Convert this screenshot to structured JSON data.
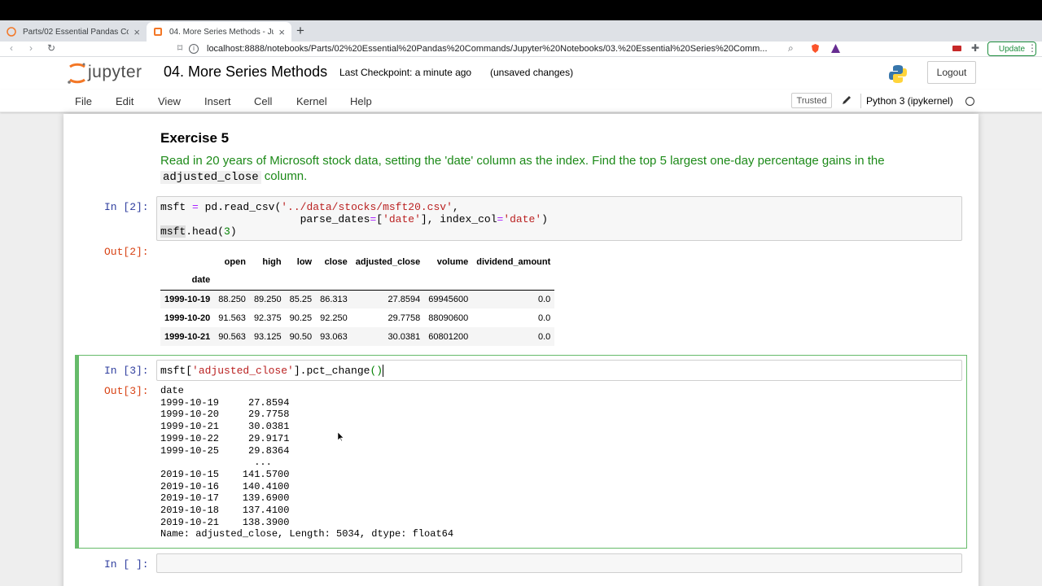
{
  "browser": {
    "tabs": [
      {
        "label": "Parts/02 Essential Pandas Comman",
        "active": false
      },
      {
        "label": "04. More Series Methods - Jupyt",
        "active": true
      }
    ],
    "url": "localhost:8888/notebooks/Parts/02%20Essential%20Pandas%20Commands/Jupyter%20Notebooks/03.%20Essential%20Series%20Comm...",
    "update_label": "Update"
  },
  "jupyter": {
    "logo_text": "jupyter",
    "notebook_title": "04. More Series Methods",
    "checkpoint": "Last Checkpoint: a minute ago",
    "save_status": "(unsaved changes)",
    "logout_label": "Logout",
    "menu": [
      "File",
      "Edit",
      "View",
      "Insert",
      "Cell",
      "Kernel",
      "Help"
    ],
    "trusted_label": "Trusted",
    "kernel_name": "Python 3 (ipykernel)"
  },
  "cells": {
    "exercise_heading": "Exercise 5",
    "exercise_text_pre": "Read in 20 years of Microsoft stock data, setting the 'date' column as the index. Find the top 5 largest one-day percentage gains in the",
    "exercise_code_word": "adjusted_close",
    "exercise_text_post": "column.",
    "cell2_in_prompt": "In [2]:",
    "cell2_out_prompt": "Out[2]:",
    "cell3_in_prompt": "In [3]:",
    "cell3_out_prompt": "Out[3]:",
    "cell4_in_prompt": "In [ ]:",
    "cell2_code": {
      "l1_a": "msft ",
      "l1_op": "=",
      "l1_b": " pd.read_csv(",
      "l1_str": "'../data/stocks/msft20.csv'",
      "l1_c": ",",
      "l2_a": "                      parse_dates",
      "l2_op": "=",
      "l2_b": "[",
      "l2_str": "'date'",
      "l2_c": "], index_col",
      "l2_op2": "=",
      "l2_str2": "'date'",
      "l2_d": ")",
      "l3_hl": "msft",
      "l3_a": ".head(",
      "l3_num": "3",
      "l3_b": ")"
    },
    "cell3_code": {
      "a": "msft[",
      "str": "'adjusted_close'",
      "b": "].pct_change",
      "paren": "()"
    },
    "dataframe": {
      "columns": [
        "open",
        "high",
        "low",
        "close",
        "adjusted_close",
        "volume",
        "dividend_amount"
      ],
      "index_name": "date",
      "rows": [
        {
          "index": "1999-10-19",
          "values": [
            "88.250",
            "89.250",
            "85.25",
            "86.313",
            "27.8594",
            "69945600",
            "0.0"
          ]
        },
        {
          "index": "1999-10-20",
          "values": [
            "91.563",
            "92.375",
            "90.25",
            "92.250",
            "29.7758",
            "88090600",
            "0.0"
          ]
        },
        {
          "index": "1999-10-21",
          "values": [
            "90.563",
            "93.125",
            "90.50",
            "93.063",
            "30.0381",
            "60801200",
            "0.0"
          ]
        }
      ]
    },
    "series_output": [
      "date",
      "1999-10-19     27.8594",
      "1999-10-20     29.7758",
      "1999-10-21     30.0381",
      "1999-10-22     29.9171",
      "1999-10-25     29.8364",
      "                ...",
      "2019-10-15    141.5700",
      "2019-10-16    140.4100",
      "2019-10-17    139.6900",
      "2019-10-18    137.4100",
      "2019-10-21    138.3900",
      "Name: adjusted_close, Length: 5034, dtype: float64"
    ]
  }
}
